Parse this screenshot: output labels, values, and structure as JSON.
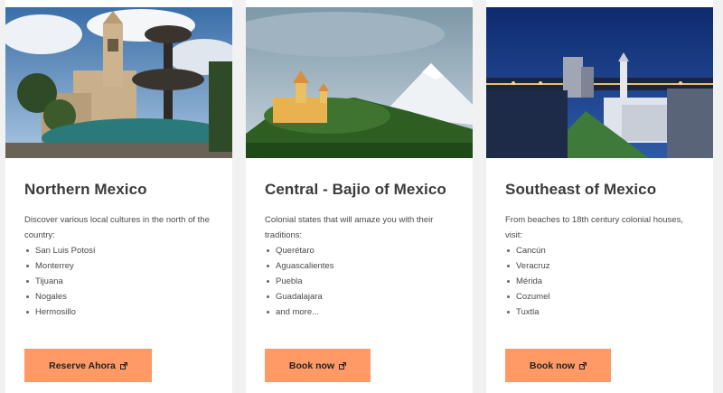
{
  "cards": [
    {
      "title": "Northern Mexico",
      "intro": "Discover various local cultures in the north of the country:",
      "items": [
        "San Luis Potosí",
        "Monterrey",
        "Tijuana",
        "Nogales",
        "Hermosillo"
      ],
      "button": "Reserve Ahora",
      "button_icon": "external-link-icon"
    },
    {
      "title": "Central - Bajio of Mexico",
      "intro": "Colonial states that will amaze you with their traditions:",
      "items": [
        "Querétaro",
        "Aguascalientes",
        "Puebla",
        "Guadalajara",
        "and more..."
      ],
      "button": "Book now",
      "button_icon": "external-link-icon"
    },
    {
      "title": "Southeast of Mexico",
      "intro": "From beaches to 18th century colonial houses, visit:",
      "items": [
        "Cancún",
        "Veracruz",
        "Mérida",
        "Cozumel",
        "Tuxtla"
      ],
      "button": "Book now",
      "button_icon": "external-link-icon"
    }
  ],
  "colors": {
    "button": "#ff9966",
    "background": "#f1f1f1",
    "card": "#ffffff",
    "title": "#3b3b3b"
  }
}
